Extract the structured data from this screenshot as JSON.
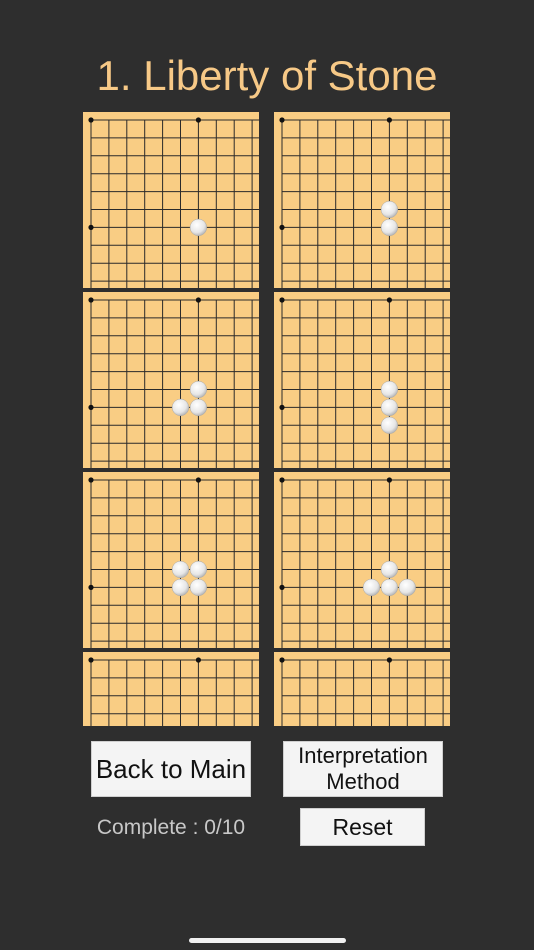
{
  "title": "1. Liberty of Stone",
  "buttons": {
    "back_to_main": "Back to Main",
    "interpretation_method": "Interpretation\nMethod",
    "reset": "Reset"
  },
  "status": {
    "complete_text": "Complete : 0/10"
  },
  "colors": {
    "background": "#2e2e2e",
    "title": "#f7c987",
    "board": "#f9cd84",
    "grid_line": "#2a2a2a",
    "stone": "#ffffff"
  },
  "boards": [
    {
      "id": 1,
      "stones": [
        [
          6,
          6
        ]
      ]
    },
    {
      "id": 2,
      "stones": [
        [
          6,
          5
        ],
        [
          6,
          6
        ]
      ]
    },
    {
      "id": 3,
      "stones": [
        [
          6,
          5
        ],
        [
          5,
          6
        ],
        [
          6,
          6
        ]
      ]
    },
    {
      "id": 4,
      "stones": [
        [
          6,
          5
        ],
        [
          6,
          6
        ],
        [
          6,
          7
        ]
      ]
    },
    {
      "id": 5,
      "stones": [
        [
          5,
          5
        ],
        [
          6,
          5
        ],
        [
          5,
          6
        ],
        [
          6,
          6
        ]
      ]
    },
    {
      "id": 6,
      "stones": [
        [
          6,
          5
        ],
        [
          5,
          6
        ],
        [
          6,
          6
        ],
        [
          7,
          6
        ]
      ]
    },
    {
      "id": 7,
      "stones": []
    },
    {
      "id": 8,
      "stones": []
    }
  ]
}
